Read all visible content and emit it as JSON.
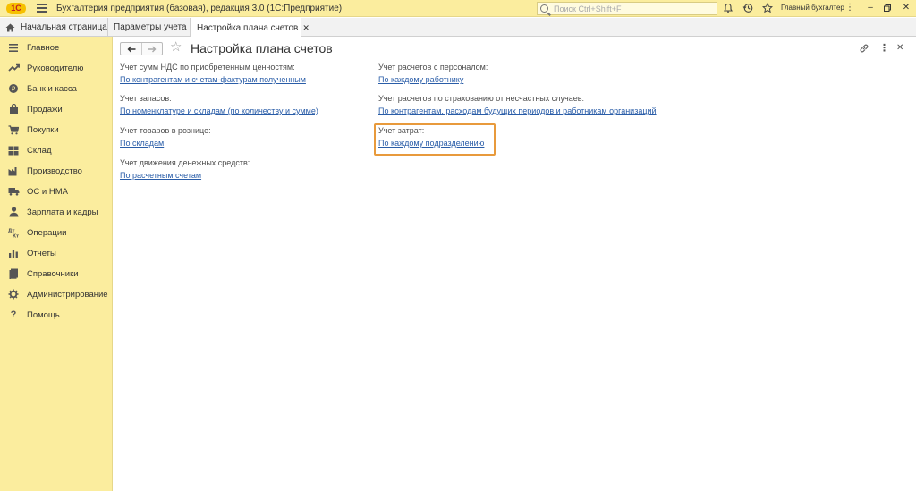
{
  "app": {
    "logo_text": "1С",
    "title": "Бухгалтерия предприятия (базовая), редакция 3.0  (1С:Предприятие)",
    "search_placeholder": "Поиск Ctrl+Shift+F",
    "user": "Главный бухгалтер",
    "icons": [
      "bell-icon",
      "history-icon",
      "star-icon"
    ],
    "accent_color": "#fbed9e"
  },
  "tabs": [
    {
      "label": "Начальная страница",
      "icon": "home-icon"
    },
    {
      "label": "Параметры учета",
      "closable": true
    },
    {
      "label": "Настройка плана счетов",
      "closable": true,
      "active": true
    }
  ],
  "sidebar": {
    "items": [
      {
        "label": "Главное",
        "icon": "list-icon"
      },
      {
        "label": "Руководителю",
        "icon": "trend-icon"
      },
      {
        "label": "Банк и касса",
        "icon": "coin-icon"
      },
      {
        "label": "Продажи",
        "icon": "bag-icon"
      },
      {
        "label": "Покупки",
        "icon": "cart-icon"
      },
      {
        "label": "Склад",
        "icon": "warehouse-icon"
      },
      {
        "label": "Производство",
        "icon": "factory-icon"
      },
      {
        "label": "ОС и НМА",
        "icon": "truck-icon"
      },
      {
        "label": "Зарплата и кадры",
        "icon": "person-icon"
      },
      {
        "label": "Операции",
        "icon": "dt-kt-icon"
      },
      {
        "label": "Отчеты",
        "icon": "bar-chart-icon"
      },
      {
        "label": "Справочники",
        "icon": "book-icon"
      },
      {
        "label": "Администрирование",
        "icon": "gear-icon"
      },
      {
        "label": "Помощь",
        "icon": "question-icon"
      }
    ]
  },
  "page": {
    "title": "Настройка плана счетов",
    "left_fields": [
      {
        "caption": "Учет сумм НДС по приобретенным ценностям:",
        "link": "По контрагентам и счетам-фактурам полученным"
      },
      {
        "caption": "Учет запасов:",
        "link": "По номенклатуре и складам (по количеству и сумме)"
      },
      {
        "caption": "Учет товаров в рознице:",
        "link": "По складам"
      },
      {
        "caption": "Учет движения денежных средств:",
        "link": "По расчетным счетам"
      }
    ],
    "right_fields": [
      {
        "caption": "Учет расчетов с персоналом:",
        "link": "По каждому работнику"
      },
      {
        "caption": "Учет расчетов по страхованию от несчастных случаев:",
        "link": "По контрагентам, расходам будущих периодов и работникам организаций"
      },
      {
        "caption": "Учет затрат:",
        "link": "По каждому подразделению"
      }
    ],
    "highlight_color": "#e89a3c"
  }
}
